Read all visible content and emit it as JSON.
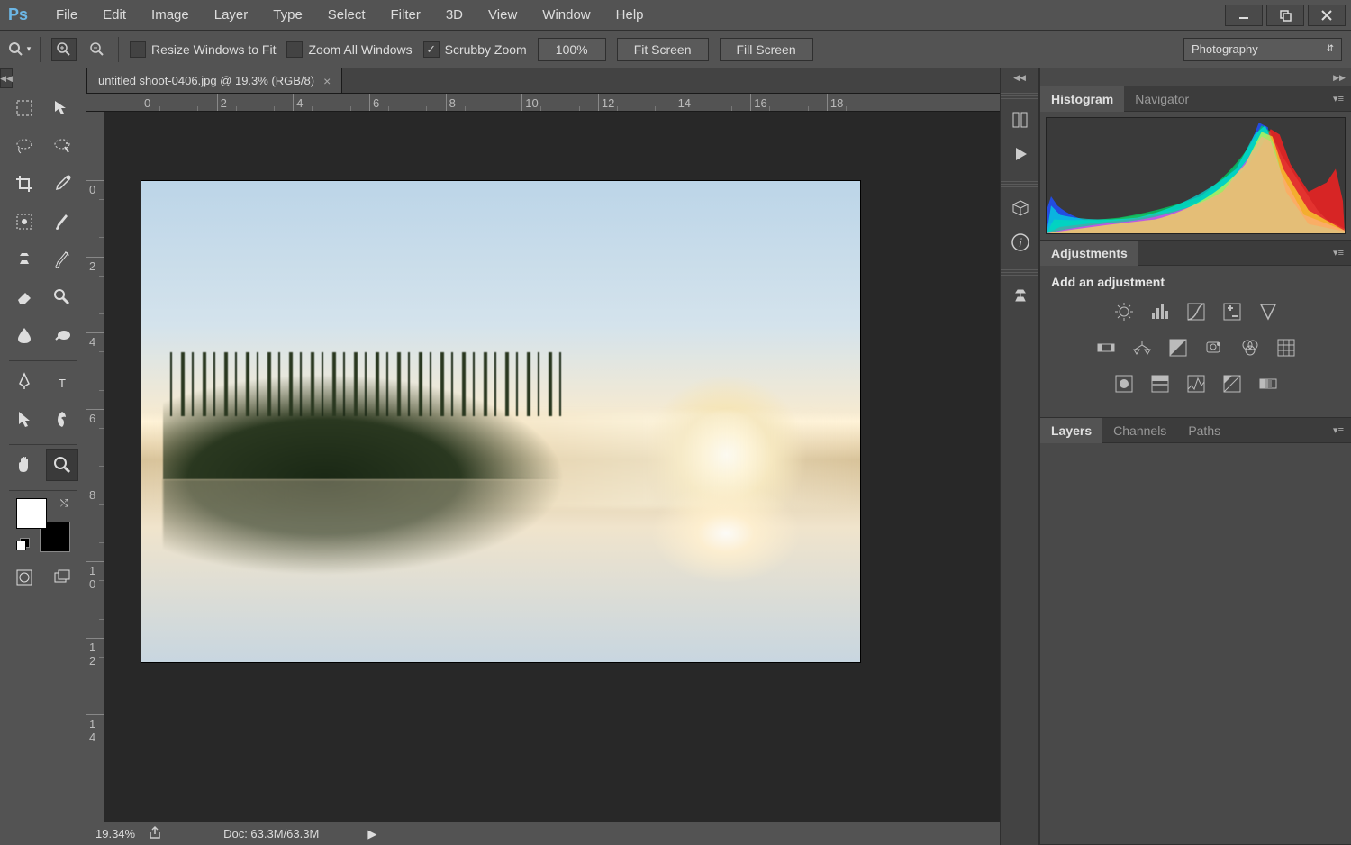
{
  "app": {
    "name": "Photoshop"
  },
  "menubar": [
    "File",
    "Edit",
    "Image",
    "Layer",
    "Type",
    "Select",
    "Filter",
    "3D",
    "View",
    "Window",
    "Help"
  ],
  "optionsbar": {
    "resize_label": "Resize Windows to Fit",
    "zoom_all_label": "Zoom All Windows",
    "scrubby_label": "Scrubby Zoom",
    "zoom_field": "100%",
    "fit_screen": "Fit Screen",
    "fill_screen": "Fill Screen",
    "workspace": "Photography",
    "checks": {
      "resize": false,
      "zoom_all": false,
      "scrubby": true
    }
  },
  "document": {
    "tab_title": "untitled shoot-0406.jpg @ 19.3% (RGB/8)",
    "ruler_h_unit": "",
    "ruler_h_labels": [
      "0",
      "2",
      "4",
      "6",
      "8",
      "10",
      "12",
      "14",
      "16",
      "18"
    ],
    "ruler_v_labels": [
      "0",
      "2",
      "4",
      "6",
      "8",
      "10",
      "12",
      "14"
    ]
  },
  "statusbar": {
    "zoom": "19.34%",
    "doc_info": "Doc: 63.3M/63.3M"
  },
  "panels": {
    "histogram_tab": "Histogram",
    "navigator_tab": "Navigator",
    "adjustments_tab": "Adjustments",
    "adjustments_title": "Add an adjustment",
    "layers_tab": "Layers",
    "channels_tab": "Channels",
    "paths_tab": "Paths"
  },
  "tools": {
    "left": [
      "marquee",
      "lasso",
      "crop",
      "quick-select",
      "clone",
      "eraser",
      "brush-blur",
      "pen",
      "path-select",
      "hand"
    ],
    "right": [
      "move",
      "magic-lasso",
      "eyedropper",
      "brush",
      "history-brush",
      "dodge",
      "paint-bucket",
      "text",
      "shape",
      "zoom"
    ],
    "bottom": [
      "quickmask",
      "screen-mode"
    ]
  },
  "adjustment_icons": [
    [
      "brightness",
      "levels",
      "curves",
      "exposure",
      "black-white-point"
    ],
    [
      "vibrance",
      "color-balance",
      "bw",
      "photo-filter",
      "channel-mixer",
      "color-lookup"
    ],
    [
      "invert",
      "posterize",
      "threshold",
      "selective-color",
      "gradient-map"
    ]
  ],
  "dock_icons": [
    "settings-icon",
    "play-icon",
    "3d-icon",
    "info-icon",
    "stamp-icon"
  ]
}
